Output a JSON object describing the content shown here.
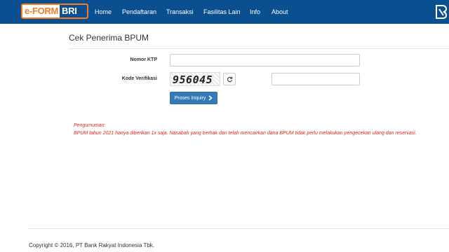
{
  "brand": {
    "logo_part1": "e-FORM",
    "logo_part2": "BRI"
  },
  "nav": {
    "items": [
      {
        "label": "Home"
      },
      {
        "label": "Pendaftaran"
      },
      {
        "label": "Transaksi"
      },
      {
        "label": "Fasilitas Lain"
      },
      {
        "label": "Info"
      },
      {
        "label": "About"
      }
    ]
  },
  "page": {
    "title": "Cek Penerima BPUM"
  },
  "form": {
    "ktp_label": "Nomor KTP",
    "ktp_value": "",
    "verification_label": "Kode Verifikasi",
    "captcha_text": "956045",
    "verification_value": "",
    "submit_label": "Proses Inquiry"
  },
  "notice": {
    "title": "Pengumuman:",
    "text": "BPUM tahun 2021 hanya diberikan 1x saja. Nasabah yang berhak dan telah mencairkan dana BPUM tidak perlu melakukan pengecekan ulang dan reservasi."
  },
  "footer": {
    "copyright": "Copyright © 2016, PT Bank Rakyat Indonesia Tbk."
  },
  "colors": {
    "navbar": "#0a4f8f",
    "accent": "#f47b20",
    "button": "#337ab7",
    "notice": "#d9261c"
  },
  "icons": {
    "refresh": "refresh-icon",
    "chevron": "chevron-right-icon",
    "brand": "bri-logo-mark"
  }
}
